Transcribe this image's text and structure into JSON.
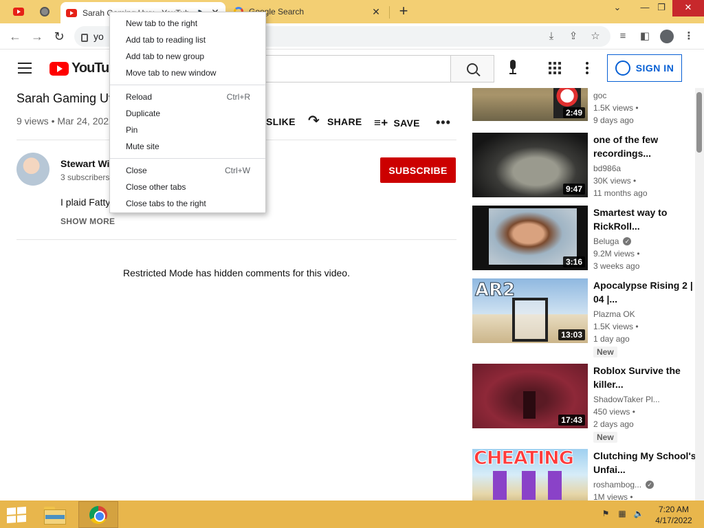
{
  "browser": {
    "tabs": [
      {
        "title": "Sarah Gaming Uwu - YouTube",
        "active": true
      },
      {
        "title": "Google Search",
        "active": false
      }
    ],
    "address": "yo",
    "window_controls": {
      "minimize": "⌄",
      "restore": "—",
      "maximize": "❐",
      "close": "✕"
    }
  },
  "context_menu": {
    "groups": [
      [
        {
          "label": "New tab to the right",
          "accel": ""
        },
        {
          "label": "Add tab to reading list",
          "accel": ""
        },
        {
          "label": "Add tab to new group",
          "accel": ""
        },
        {
          "label": "Move tab to new window",
          "accel": ""
        }
      ],
      [
        {
          "label": "Reload",
          "accel": "Ctrl+R"
        },
        {
          "label": "Duplicate",
          "accel": ""
        },
        {
          "label": "Pin",
          "accel": ""
        },
        {
          "label": "Mute site",
          "accel": ""
        }
      ],
      [
        {
          "label": "Close",
          "accel": "Ctrl+W"
        },
        {
          "label": "Close other tabs",
          "accel": ""
        },
        {
          "label": "Close tabs to the right",
          "accel": ""
        }
      ]
    ]
  },
  "youtube": {
    "logo": "YouTube",
    "signin": "SIGN IN",
    "video": {
      "title": "Sarah Gaming Uv",
      "meta": "9 views • Mar 24, 2022",
      "dislike": "SLIKE",
      "share": "SHARE",
      "save": "SAVE",
      "channel_name": "Stewart Wi",
      "subscribers": "3 subscribers",
      "subscribe": "SUBSCRIBE",
      "description": "I plaid Fatty",
      "show_more": "SHOW MORE",
      "comments_notice": "Restricted Mode has hidden comments for this video."
    },
    "recommendations": [
      {
        "title": "",
        "channel": "goc",
        "verified": false,
        "views": "1.5K views •",
        "age": "9 days ago",
        "duration": "2:49",
        "badge": ""
      },
      {
        "title": "one of the few recordings...",
        "channel": "bd986a",
        "verified": false,
        "views": "30K views •",
        "age": "11 months ago",
        "duration": "9:47",
        "badge": ""
      },
      {
        "title": "Smartest way to RickRoll...",
        "channel": "Beluga",
        "verified": true,
        "views": "9.2M views •",
        "age": "3 weeks ago",
        "duration": "3:16",
        "badge": ""
      },
      {
        "title": "Apocalypse Rising 2 | 04 |...",
        "channel": "Plazma OK",
        "verified": false,
        "views": "1.5K views •",
        "age": "1 day ago",
        "duration": "13:03",
        "badge": "New"
      },
      {
        "title": "Roblox Survive the killer...",
        "channel": "ShadowTaker Pl...",
        "verified": false,
        "views": "450 views •",
        "age": "2 days ago",
        "duration": "17:43",
        "badge": "New"
      },
      {
        "title": "Clutching My School's Unfai...",
        "channel": "roshambog...",
        "verified": true,
        "views": "1M views •",
        "age": "",
        "duration": "",
        "badge": ""
      }
    ],
    "thumb_texts": {
      "ar2": "AR2",
      "cheating": "CHEATING"
    }
  },
  "taskbar": {
    "time": "7:20 AM",
    "date": "4/17/2022"
  }
}
